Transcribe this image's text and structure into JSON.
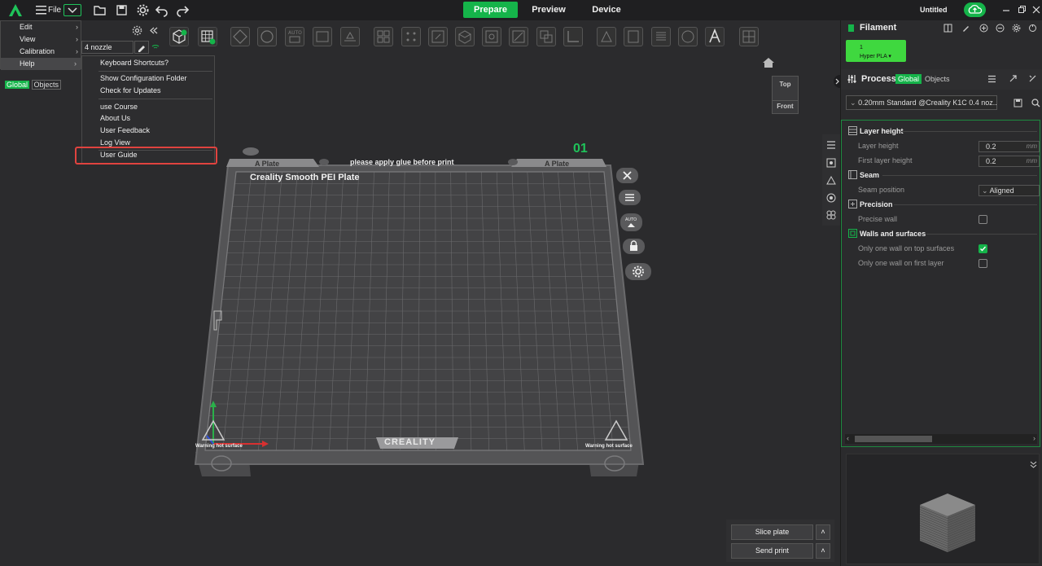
{
  "topbar": {
    "file_label": "File",
    "tabs": [
      "Prepare",
      "Preview",
      "Device"
    ],
    "active_tab": "Prepare",
    "project_title": "Untitled"
  },
  "printer": {
    "nozzle_label": "4 nozzle"
  },
  "scope_toggle": {
    "global": "Global",
    "objects": "Objects"
  },
  "main_menu": {
    "items": [
      {
        "label": "Edit"
      },
      {
        "label": "View"
      },
      {
        "label": "Calibration"
      },
      {
        "label": "Help"
      }
    ]
  },
  "help_menu": {
    "items": [
      {
        "label": "Keyboard Shortcuts?"
      },
      {
        "label": "Show Configuration Folder"
      },
      {
        "label": "Check for Updates"
      },
      {
        "label": "use Course"
      },
      {
        "label": "About Us"
      },
      {
        "label": "User Feedback"
      },
      {
        "label": "Log View"
      },
      {
        "label": "User Guide"
      }
    ],
    "highlighted": "User Guide"
  },
  "plate": {
    "tab_left": "A Plate",
    "tab_right": "A Plate",
    "notice": "please apply glue before print",
    "title": "Creality Smooth PEI Plate",
    "number": "01",
    "brand": "CREALITY",
    "warning_left": "Warning hot surface",
    "warning_right": "Warning hot surface"
  },
  "view_cube": {
    "top": "Top",
    "front": "Front"
  },
  "filament": {
    "title": "Filament",
    "slot_number": "1",
    "slot_name": "Hyper PLA",
    "slot_color": "#3fd83f"
  },
  "process": {
    "title": "Process",
    "global": "Global",
    "objects": "Objects",
    "preset": "0.20mm Standard @Creality K1C 0.4 noz..."
  },
  "settings": {
    "layer_height_group": "Layer height",
    "layer_height_label": "Layer height",
    "layer_height_value": "0.2",
    "first_layer_height_label": "First layer height",
    "first_layer_height_value": "0.2",
    "unit": "mm",
    "seam_group": "Seam",
    "seam_position_label": "Seam position",
    "seam_position_value": "Aligned",
    "precision_group": "Precision",
    "precise_wall_label": "Precise wall",
    "precise_wall_checked": false,
    "walls_group": "Walls and surfaces",
    "one_wall_top_label": "Only one wall on top surfaces",
    "one_wall_top_checked": true,
    "one_wall_first_label": "Only one wall on first layer",
    "one_wall_first_checked": false
  },
  "actions": {
    "slice": "Slice plate",
    "send": "Send print"
  },
  "colors": {
    "accent": "#15b44a",
    "highlight_box": "#e0433f"
  }
}
